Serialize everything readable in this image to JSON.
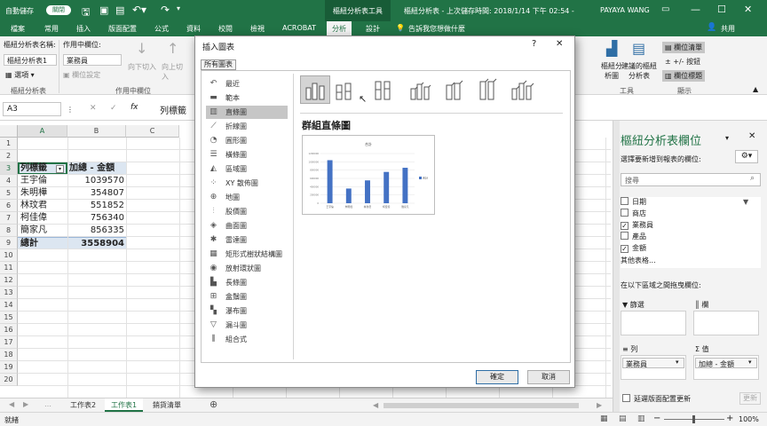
{
  "titlebar": {
    "autosave": "自動儲存",
    "toggle": "關閉",
    "context_tab": "樞紐分析表工具",
    "doc_title": "樞紐分析表 - 上次儲存時間: 2018/1/14 下午 02:54 -",
    "user": "PAYAYA WANG"
  },
  "tabs": [
    "檔案",
    "常用",
    "插入",
    "版面配置",
    "公式",
    "資料",
    "校閱",
    "檢視",
    "ACROBAT",
    "分析",
    "設計"
  ],
  "tell_me": "告訴我您想做什麼",
  "share": "共用",
  "ribbon": {
    "pt_name_label": "樞紐分析表名稱:",
    "pt_name_value": "樞紐分析表1",
    "options_btn": "選項",
    "group_pt": "樞紐分析表",
    "active_field_label": "作用中欄位:",
    "active_field_value": "業務員",
    "field_settings": "欄位設定",
    "drill_down": "向下切入",
    "drill_up": "向上切入",
    "group_active": "作用中欄位",
    "pivot_chart": "樞紐分析圖",
    "recommended": "建議的樞紐分析表",
    "group_tools": "工具",
    "field_list": "欄位清單",
    "plus_minus": "+/- 按鈕",
    "field_headers": "欄位標題",
    "group_show": "顯示"
  },
  "formula": {
    "name_box": "A3",
    "cancel": "✕",
    "enter": "✓",
    "fx": "fx",
    "content": "列標籤"
  },
  "columns": [
    "A",
    "B",
    "C"
  ],
  "rows": [
    "1",
    "2",
    "3",
    "4",
    "5",
    "6",
    "7",
    "8",
    "9",
    "10",
    "11",
    "12",
    "13",
    "14",
    "15",
    "16",
    "17",
    "18",
    "19",
    "20"
  ],
  "pivot": {
    "header": [
      "列標籤",
      "加總 - 金額"
    ],
    "data": [
      [
        "王宇倫",
        "1039570"
      ],
      [
        "朱明樺",
        "354807"
      ],
      [
        "林玟君",
        "551852"
      ],
      [
        "柯佳偉",
        "756340"
      ],
      [
        "簡家凡",
        "856335"
      ]
    ],
    "total": [
      "總計",
      "3558904"
    ]
  },
  "sheets": [
    "工作表2",
    "工作表1",
    "銷貨清單"
  ],
  "status": {
    "ready": "就緒",
    "zoom": "100%"
  },
  "dialog": {
    "title": "插入圖表",
    "help": "?",
    "close": "✕",
    "tab": "所有圖表",
    "chart_types": [
      {
        "label": "最近",
        "icon": "recent-icon",
        "sym": "↶"
      },
      {
        "label": "範本",
        "icon": "folder-icon",
        "sym": "▬"
      },
      {
        "label": "直條圖",
        "icon": "column-chart-icon",
        "sym": "▥"
      },
      {
        "label": "折線圖",
        "icon": "line-chart-icon",
        "sym": "⟋"
      },
      {
        "label": "圓形圖",
        "icon": "pie-chart-icon",
        "sym": "◔"
      },
      {
        "label": "橫條圖",
        "icon": "bar-chart-icon",
        "sym": "☰"
      },
      {
        "label": "區域圖",
        "icon": "area-chart-icon",
        "sym": "◭"
      },
      {
        "label": "XY 散佈圖",
        "icon": "scatter-chart-icon",
        "sym": "⁘"
      },
      {
        "label": "地圖",
        "icon": "map-chart-icon",
        "sym": "⊕"
      },
      {
        "label": "股價圖",
        "icon": "stock-chart-icon",
        "sym": "⫶"
      },
      {
        "label": "曲面圖",
        "icon": "surface-chart-icon",
        "sym": "◈"
      },
      {
        "label": "雷達圖",
        "icon": "radar-chart-icon",
        "sym": "✱"
      },
      {
        "label": "矩形式樹狀結構圖",
        "icon": "treemap-icon",
        "sym": "▦"
      },
      {
        "label": "放射環狀圖",
        "icon": "sunburst-icon",
        "sym": "◉"
      },
      {
        "label": "長條圖",
        "icon": "histogram-icon",
        "sym": "▙"
      },
      {
        "label": "盒鬚圖",
        "icon": "box-whisker-icon",
        "sym": "⊞"
      },
      {
        "label": "瀑布圖",
        "icon": "waterfall-icon",
        "sym": "▚"
      },
      {
        "label": "漏斗圖",
        "icon": "funnel-icon",
        "sym": "▽"
      },
      {
        "label": "組合式",
        "icon": "combo-chart-icon",
        "sym": "⫼"
      }
    ],
    "selected_type": 2,
    "variant_title": "群組直條圖",
    "ok": "確定",
    "cancel": "取消",
    "preview_title": "合計",
    "preview_legend": "合計"
  },
  "chart_data": {
    "type": "bar",
    "categories": [
      "王宇倫",
      "朱明樺",
      "林玟君",
      "柯佳偉",
      "簡家凡"
    ],
    "values": [
      1039570,
      354807,
      551852,
      756340,
      856335
    ],
    "title": "合計",
    "ylim": [
      0,
      1200000
    ],
    "grid": true,
    "legend": "right"
  },
  "pane": {
    "title": "樞紐分析表欄位",
    "subtitle": "選擇要新增到報表的欄位:",
    "search_placeholder": "搜尋",
    "fields": [
      {
        "label": "日期",
        "checked": false
      },
      {
        "label": "商店",
        "checked": false
      },
      {
        "label": "業務員",
        "checked": true
      },
      {
        "label": "產品",
        "checked": false
      },
      {
        "label": "金額",
        "checked": true
      }
    ],
    "more_tables": "其他表格...",
    "drag_label": "在以下區域之間拖曳欄位:",
    "filters": "篩選",
    "columns": "欄",
    "rows": "列",
    "values": "值",
    "rows_item": "業務員",
    "values_item": "加總 - 金額",
    "defer": "延遲版面配置更新",
    "update": "更新"
  },
  "colors": {
    "excel_green": "#217346",
    "chart_blue": "#4472c4",
    "pivot_header": "#dce6f1"
  }
}
